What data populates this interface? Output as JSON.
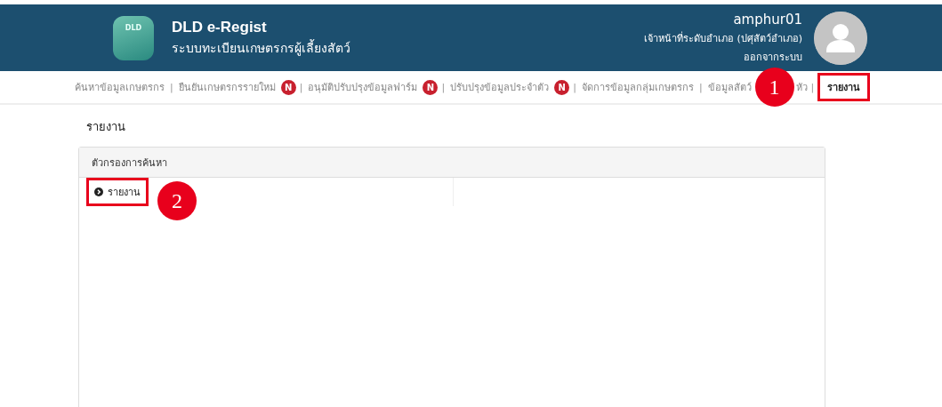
{
  "header": {
    "app_name": "DLD e-Regist",
    "subtitle": "ระบบทะเบียนเกษตรกรผู้เลี้ยงสัตว์",
    "username": "amphur01",
    "role": "เจ้าหน้าที่ระดับอำเภอ (ปศุสัตว์อำเภอ)",
    "logout": "ออกจากระบบ",
    "logo_text": "DLD"
  },
  "nav": [
    {
      "label": "ค้นหาข้อมูลเกษตรกร",
      "selected": false,
      "highlighted": false
    },
    {
      "separator": "|",
      "label": "ยืนยันเกษตรกรรายใหม่",
      "badge": "N",
      "selected": false,
      "highlighted": false
    },
    {
      "separator": "|",
      "label": "อนุมัติปรับปรุงข้อมูลฟาร์ม",
      "badge": "N",
      "selected": false,
      "highlighted": false
    },
    {
      "separator": "|",
      "label": "ปรับปรุงข้อมูลประจำตัว",
      "badge": "N",
      "selected": false,
      "highlighted": false
    },
    {
      "separator": "|",
      "label": "จัดการข้อมูลกลุ่มเกษตรกร",
      "selected": false,
      "highlighted": false
    },
    {
      "separator": "|",
      "label": "ข้อมูลสัตว์",
      "tail": "หัว",
      "selected": false,
      "highlighted": false
    },
    {
      "separator": "|",
      "label": "รายงาน",
      "selected": true,
      "highlighted": true
    }
  ],
  "page_title": "รายงาน",
  "panel": {
    "title": "ตัวกรองการค้นหา",
    "items": [
      {
        "label": "รายงาน",
        "highlighted": true
      }
    ]
  },
  "callouts": [
    {
      "number": "1"
    },
    {
      "number": "2"
    }
  ]
}
